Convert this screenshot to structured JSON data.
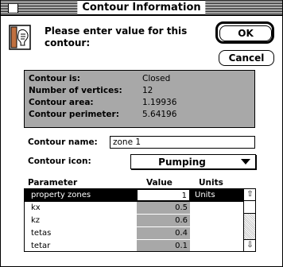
{
  "window": {
    "title": "Contour Information"
  },
  "prompt": {
    "line1": "Please enter value for this",
    "line2": "contour:"
  },
  "buttons": {
    "ok": "OK",
    "cancel": "Cancel"
  },
  "info": [
    {
      "label": "Contour is:",
      "value": "Closed"
    },
    {
      "label": "Number of vertices:",
      "value": "12"
    },
    {
      "label": "Contour area:",
      "value": "1.19936"
    },
    {
      "label": "Contour perimeter:",
      "value": "5.64196"
    }
  ],
  "contour_name": {
    "label": "Contour name:",
    "value": "zone 1"
  },
  "contour_icon": {
    "label": "Contour icon:",
    "value": "Pumping"
  },
  "table": {
    "headers": {
      "parameter": "Parameter",
      "value": "Value",
      "units": "Units"
    },
    "rows": [
      {
        "parameter": "property zones",
        "value": "1",
        "units": "Units"
      },
      {
        "parameter": "kx",
        "value": "0.5",
        "units": ""
      },
      {
        "parameter": "kz",
        "value": "0.6",
        "units": ""
      },
      {
        "parameter": "tetas",
        "value": "0.4",
        "units": ""
      },
      {
        "parameter": "tetar",
        "value": "0.1",
        "units": ""
      }
    ]
  },
  "icons": {
    "close": "close-box-icon",
    "document": "document-speaker-icon",
    "dropdown": "triangle-down-icon",
    "scroll_up": "arrow-up-icon",
    "scroll_down": "arrow-down-icon"
  }
}
